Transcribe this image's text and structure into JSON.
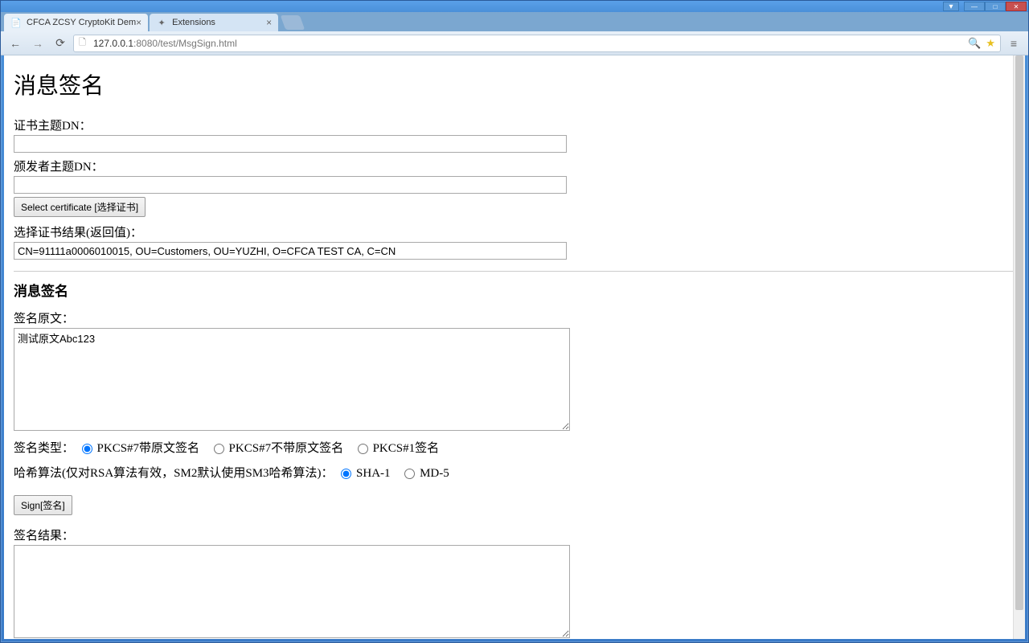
{
  "window": {
    "tabs": [
      {
        "title": "CFCA ZCSY CryptoKit Dem",
        "active": true
      },
      {
        "title": "Extensions",
        "active": false
      }
    ],
    "url_host": "127.0.0.1",
    "url_port": ":8080",
    "url_path": "/test/MsgSign.html"
  },
  "page": {
    "title": "消息签名",
    "subject_dn_label": "证书主题DN：",
    "subject_dn_value": "",
    "issuer_dn_label": "颁发者主题DN：",
    "issuer_dn_value": "",
    "select_cert_button": "Select certificate [选择证书]",
    "select_result_label": "选择证书结果(返回值)：",
    "select_result_value": "CN=91111a0006010015, OU=Customers, OU=YUZHI, O=CFCA TEST CA, C=CN",
    "section_title": "消息签名",
    "source_label": "签名原文：",
    "source_value": "测试原文Abc123",
    "sign_type_label": "签名类型：",
    "sign_type_options": {
      "pkcs7_attached": "PKCS#7带原文签名",
      "pkcs7_detached": "PKCS#7不带原文签名",
      "pkcs1": "PKCS#1签名"
    },
    "hash_label": "哈希算法(仅对RSA算法有效，SM2默认使用SM3哈希算法)：",
    "hash_options": {
      "sha1": "SHA-1",
      "md5": "MD-5"
    },
    "sign_button": "Sign[签名]",
    "result_label": "签名结果：",
    "result_value": ""
  }
}
